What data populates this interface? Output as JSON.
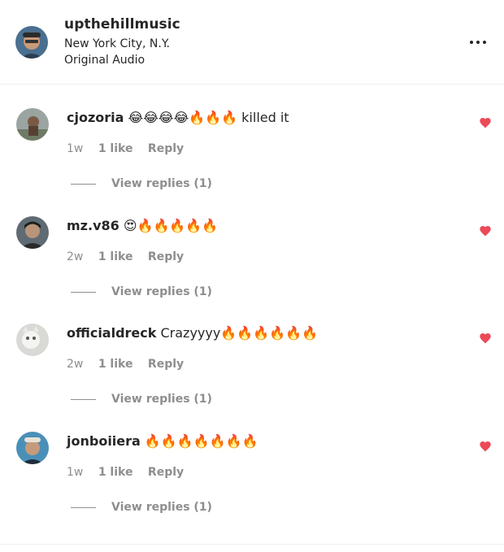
{
  "colors": {
    "heart": "#ed4956",
    "muted": "#8e8e8e",
    "text": "#262626"
  },
  "icons": {
    "more": "more-horizontal-icon",
    "like": "heart-filled-icon"
  },
  "post": {
    "username": "upthehillmusic",
    "location": "New York City, N.Y.",
    "audio": "Original Audio"
  },
  "comments": [
    {
      "username": "cjozoria",
      "text": "😂😂😂😂🔥🔥🔥 killed it",
      "time": "1w",
      "likes": "1 like",
      "reply": "Reply",
      "view_replies": "View replies (1)",
      "liked": true
    },
    {
      "username": "mz.v86",
      "text": "😍🔥🔥🔥🔥🔥",
      "time": "2w",
      "likes": "1 like",
      "reply": "Reply",
      "view_replies": "View replies (1)",
      "liked": true
    },
    {
      "username": "officialdreck",
      "text": "Crazyyyy🔥🔥🔥🔥🔥🔥",
      "time": "2w",
      "likes": "1 like",
      "reply": "Reply",
      "view_replies": "View replies (1)",
      "liked": true
    },
    {
      "username": "jonboiiera",
      "text": "🔥🔥🔥🔥🔥🔥🔥",
      "time": "1w",
      "likes": "1 like",
      "reply": "Reply",
      "view_replies": "View replies (1)",
      "liked": true
    }
  ]
}
